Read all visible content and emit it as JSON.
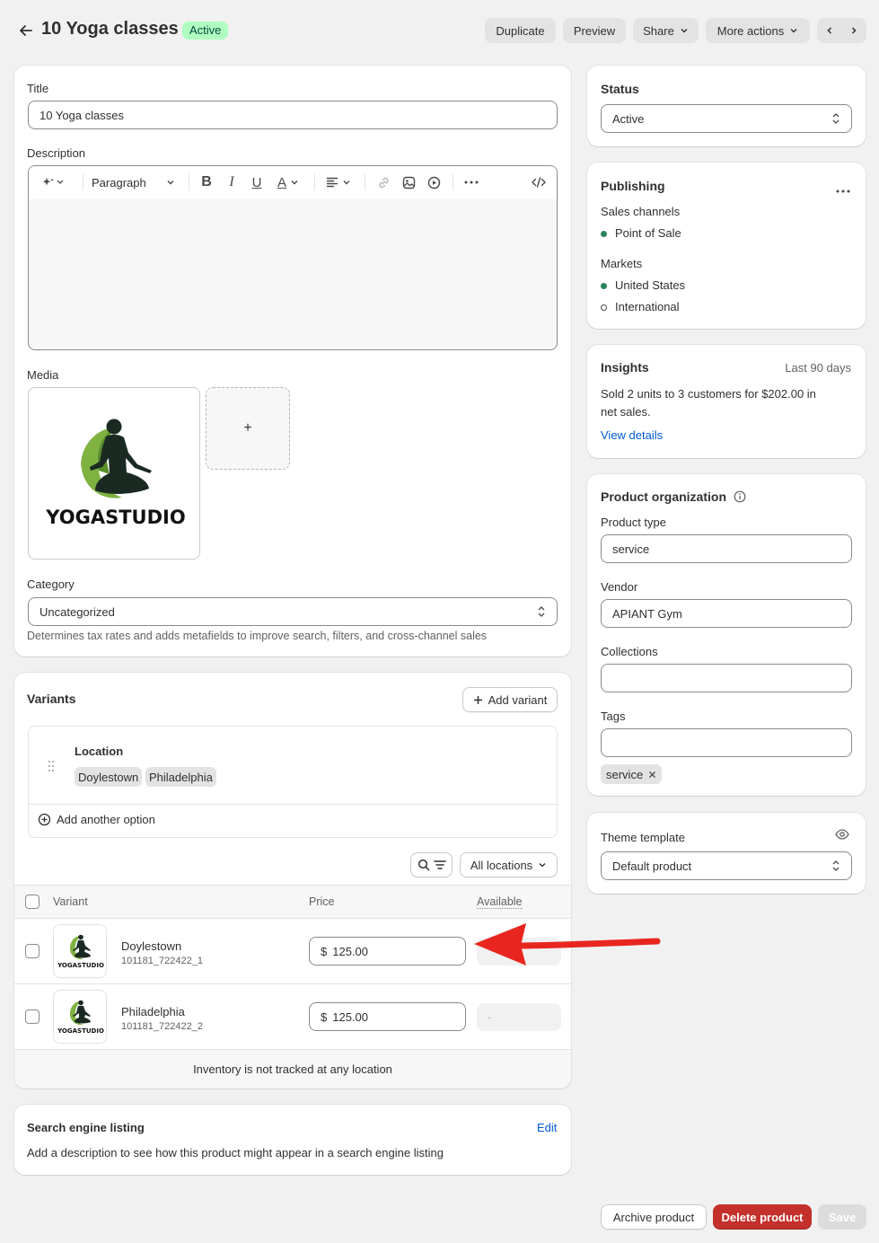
{
  "header": {
    "title": "10 Yoga classes",
    "status_badge": "Active",
    "duplicate": "Duplicate",
    "preview": "Preview",
    "share": "Share",
    "more_actions": "More actions"
  },
  "main": {
    "title_label": "Title",
    "title_value": "10 Yoga classes",
    "description_label": "Description",
    "paragraph_label": "Paragraph",
    "media_label": "Media",
    "media_add": "+",
    "logo_text": "YOGASTUDIO",
    "category_label": "Category",
    "category_value": "Uncategorized",
    "category_help": "Determines tax rates and adds metafields to improve search, filters, and cross-channel sales"
  },
  "variants": {
    "heading": "Variants",
    "add_variant": "Add variant",
    "option_name": "Location",
    "option_values": [
      "Doylestown",
      "Philadelphia"
    ],
    "add_another_option": "Add another option",
    "all_locations": "All locations",
    "col_variant": "Variant",
    "col_price": "Price",
    "col_available": "Available",
    "rows": [
      {
        "name": "Doylestown",
        "sku": "101181_722422_1",
        "currency": "$",
        "price": "125.00",
        "available": ""
      },
      {
        "name": "Philadelphia",
        "sku": "101181_722422_2",
        "currency": "$",
        "price": "125.00",
        "available": "-"
      }
    ],
    "footer_note": "Inventory is not tracked at any location"
  },
  "seo": {
    "heading": "Search engine listing",
    "edit": "Edit",
    "description": "Add a description to see how this product might appear in a search engine listing"
  },
  "status": {
    "heading": "Status",
    "value": "Active"
  },
  "publishing": {
    "heading": "Publishing",
    "sales_channels_label": "Sales channels",
    "sales_channels": [
      "Point of Sale"
    ],
    "markets_label": "Markets",
    "markets": [
      "United States",
      "International"
    ]
  },
  "insights": {
    "heading": "Insights",
    "period": "Last 90 days",
    "text": "Sold 2 units to 3 customers for $202.00 in net sales.",
    "link": "View details"
  },
  "organization": {
    "heading": "Product organization",
    "product_type_label": "Product type",
    "product_type_value": "service",
    "vendor_label": "Vendor",
    "vendor_value": "APIANT Gym",
    "collections_label": "Collections",
    "collections_value": "",
    "tags_label": "Tags",
    "tags_value": "",
    "tags": [
      "service"
    ]
  },
  "theme": {
    "heading": "Theme template",
    "value": "Default product"
  },
  "footer": {
    "archive": "Archive product",
    "delete": "Delete product",
    "save": "Save"
  },
  "colors": {
    "badge_bg": "#affebf",
    "badge_text": "#014b40",
    "link": "#005bd3",
    "delete_bg": "#c4302b",
    "dot_filled": "#29845a",
    "arrow": "#e8261f"
  }
}
